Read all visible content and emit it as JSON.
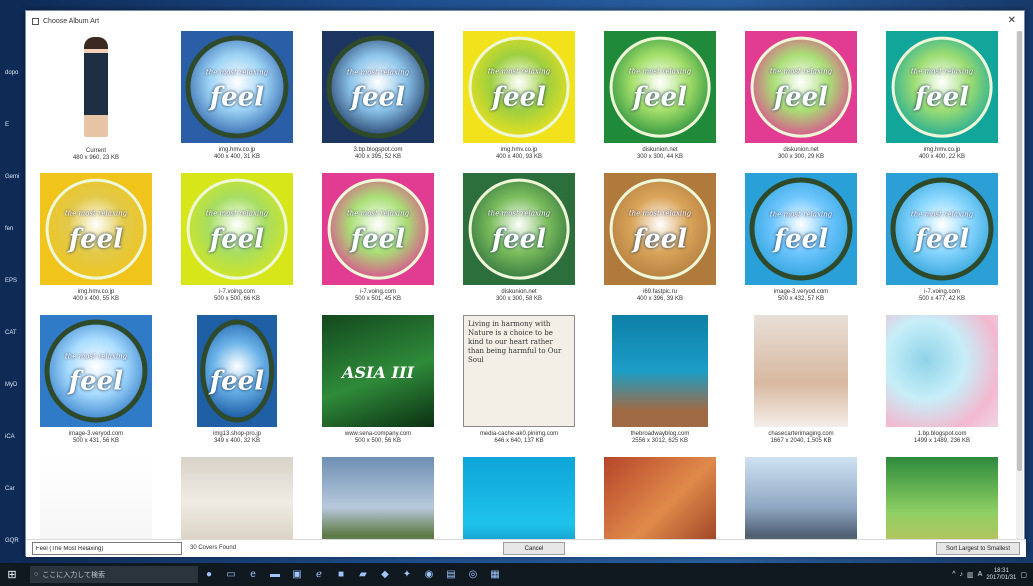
{
  "window": {
    "title": "Choose Album Art",
    "close_glyph": "✕"
  },
  "desktop_labels": [
    "dopo",
    "E",
    "Gemi",
    "fen",
    "EPS",
    "CAT",
    "MyD",
    "iCA",
    "Car",
    "GQR"
  ],
  "results": [
    {
      "source": "Current",
      "dims": "480 x 960, 23 KB",
      "art": "person"
    },
    {
      "source": "img.hmv.co.jp",
      "dims": "400 x 400, 31 KB",
      "art": "feel-sky",
      "tagline": "the most relaxing"
    },
    {
      "source": "3.bp.blogspot.com",
      "dims": "400 x 395, 52 KB",
      "art": "feel-sky-dark",
      "tagline": "the most relaxing"
    },
    {
      "source": "img.hmv.co.jp",
      "dims": "400 x 400, 93 KB",
      "art": "feel-yellow",
      "tagline": "the most relaxing"
    },
    {
      "source": "diskunion.net",
      "dims": "300 x 300, 44 KB",
      "art": "feel-green",
      "tagline": "the most relaxing"
    },
    {
      "source": "diskunion.net",
      "dims": "300 x 300, 29 KB",
      "art": "feel-pink",
      "tagline": "the most relaxing"
    },
    {
      "source": "img.hmv.co.jp",
      "dims": "400 x 400, 22 KB",
      "art": "feel-teal",
      "tagline": "the most relaxing"
    },
    {
      "source": "img.hmv.co.jp",
      "dims": "400 x 400, 55 KB",
      "art": "feel-autumn",
      "tagline": "the most relaxing"
    },
    {
      "source": "i-7.voing.com",
      "dims": "500 x 500, 66 KB",
      "art": "feel-lime",
      "tagline": "the most relaxing"
    },
    {
      "source": "i-7.voing.com",
      "dims": "500 x 501, 45 KB",
      "art": "feel-pink",
      "tagline": "the most relaxing"
    },
    {
      "source": "diskunion.net",
      "dims": "300 x 300, 58 KB",
      "art": "feel-forest",
      "tagline": "the most relaxing"
    },
    {
      "source": "i69.fastpic.ru",
      "dims": "400 x 396, 39 KB",
      "art": "feel-brown",
      "tagline": "the most relaxing"
    },
    {
      "source": "image-3.veryod.com",
      "dims": "500 x 432, 57 KB",
      "art": "feel-best",
      "tagline": "the most relaxing"
    },
    {
      "source": "i-7.voing.com",
      "dims": "500 x 477, 42 KB",
      "art": "feel-best2",
      "tagline": "the most relaxing"
    },
    {
      "source": "image-3.veryod.com",
      "dims": "500 x 431, 56 KB",
      "art": "feel-sky2",
      "tagline": "the most relaxing"
    },
    {
      "source": "img13.shop-pro.jp",
      "dims": "349 x 400, 32 KB",
      "art": "feel-blue",
      "tagline": ""
    },
    {
      "source": "www.sena-company.com",
      "dims": "500 x 500, 56 KB",
      "art": "asia",
      "tagline": "ASIA III"
    },
    {
      "source": "media-cache-ak0.pinimg.com",
      "dims": "646 x 640, 137 KB",
      "art": "quote",
      "tagline": "Living in harmony with Nature is a choice to be kind to our heart rather than being harmful to Our Soul"
    },
    {
      "source": "thebroadwayblog.com",
      "dims": "2556 x 3012, 625 KB",
      "art": "man",
      "tagline": ""
    },
    {
      "source": "chasecarterimaging.com",
      "dims": "1667 x 2040, 1,505 KB",
      "art": "baby",
      "tagline": ""
    },
    {
      "source": "1.bp.blogspot.com",
      "dims": "1499 x 1489, 236 KB",
      "art": "bath",
      "tagline": ""
    },
    {
      "source": "",
      "dims": "",
      "art": "fashion",
      "tagline": ""
    },
    {
      "source": "",
      "dims": "",
      "art": "interior",
      "tagline": ""
    },
    {
      "source": "",
      "dims": "",
      "art": "lake",
      "tagline": ""
    },
    {
      "source": "",
      "dims": "",
      "art": "diver",
      "tagline": ""
    },
    {
      "source": "",
      "dims": "",
      "art": "collage",
      "tagline": ""
    },
    {
      "source": "",
      "dims": "",
      "art": "house",
      "tagline": ""
    },
    {
      "source": "",
      "dims": "",
      "art": "fairy",
      "tagline": ""
    }
  ],
  "footer": {
    "search_value": "Feel (The Most Relaxing)",
    "found_text": "30 Covers Found",
    "cancel_label": "Cancel",
    "sort_label": "Sort Largest to Smallest"
  },
  "taskbar": {
    "search_placeholder": "ここに入力して検索",
    "ime": "A",
    "time": "18:31",
    "date": "2017/01/31"
  },
  "colors": {
    "dialog_bg": "#ffffff",
    "desktop": "#1f4f8f",
    "taskbar": "#101820"
  }
}
